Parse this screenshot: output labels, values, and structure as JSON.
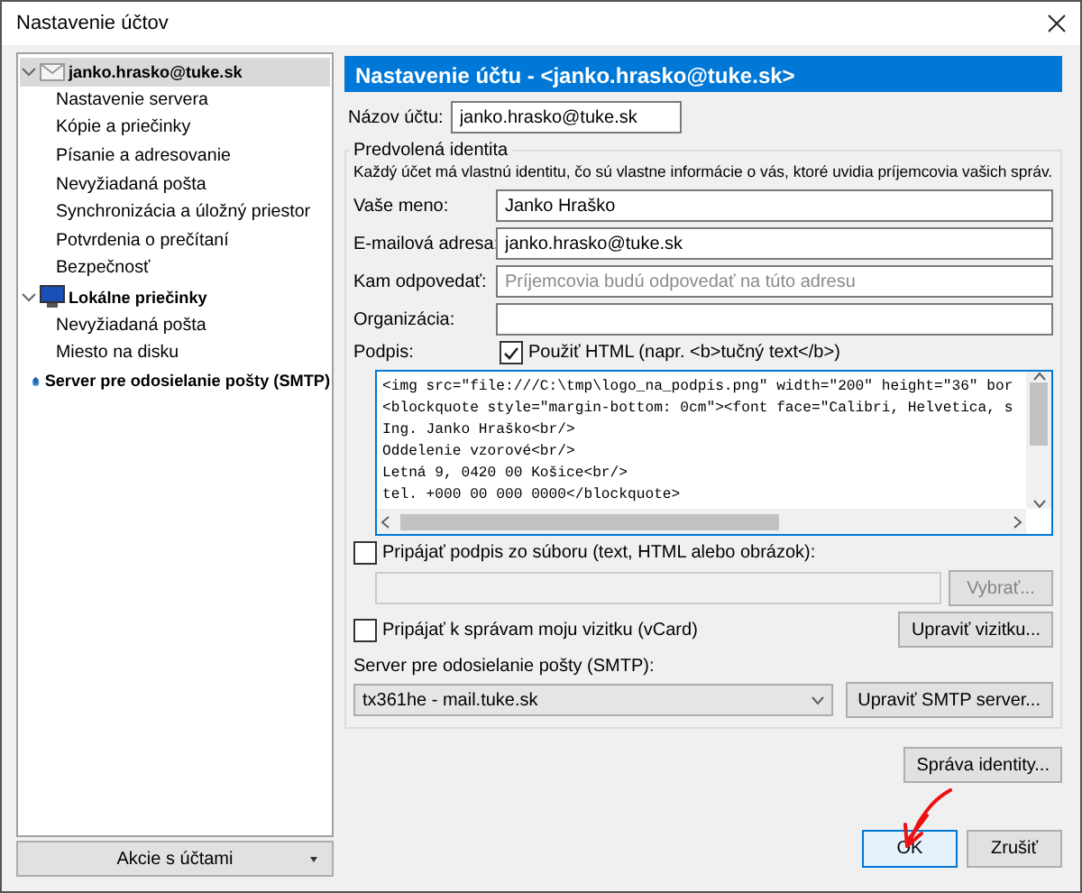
{
  "window": {
    "title": "Nastavenie účtov"
  },
  "tree": [
    {
      "label": "janko.hrasko@tuke.sk",
      "kind": "account",
      "selected": true,
      "expanded": true,
      "children": [
        {
          "label": "Nastavenie servera",
          "selected": false
        },
        {
          "label": "Kópie a priečinky",
          "selected": false
        },
        {
          "label": "Písanie a adresovanie",
          "selected": false
        },
        {
          "label": "Nevyžiadaná pošta",
          "selected": false
        },
        {
          "label": "Synchronizácia a úložný priestor",
          "selected": false
        },
        {
          "label": "Potvrdenia o prečítaní",
          "selected": false
        },
        {
          "label": "Bezpečnosť",
          "selected": false
        }
      ]
    },
    {
      "label": "Lokálne priečinky",
      "kind": "local",
      "selected": false,
      "expanded": true,
      "children": [
        {
          "label": "Nevyžiadaná pošta",
          "selected": false
        },
        {
          "label": "Miesto na disku",
          "selected": false
        }
      ]
    },
    {
      "label": "Server pre odosielanie pošty (SMTP)",
      "kind": "smtp",
      "selected": false
    }
  ],
  "account_actions": {
    "label": "Akcie s účtami"
  },
  "header": {
    "title": "Nastavenie účtu - <janko.hrasko@tuke.sk>"
  },
  "account_name": {
    "label": "Názov účtu:",
    "value": "janko.hrasko@tuke.sk"
  },
  "identity": {
    "legend": "Predvolená identita",
    "description": "Každý účet má vlastnú identitu, čo sú vlastne informácie o vás, ktoré uvidia príjemcovia vašich správ.",
    "fields": [
      {
        "label": "Vaše meno:",
        "value": "Janko Hraško"
      },
      {
        "label": "E-mailová adresa:",
        "value": "janko.hrasko@tuke.sk"
      },
      {
        "label": "Kam odpovedať:",
        "placeholder": "Príjemcovia budú odpovedať na túto adresu"
      },
      {
        "label": "Organizácia:"
      }
    ],
    "signature": {
      "label": "Podpis:",
      "use_html": {
        "label": "Použiť HTML (napr. <b>tučný text</b>)",
        "checked": true
      },
      "lines": [
        "<img src=\"file:///C:\\tmp\\logo_na_podpis.png\" width=\"200\" height=\"36\" bor",
        "<blockquote style=\"margin-bottom: 0cm\"><font face=\"Calibri, Helvetica, s",
        "Ing. Janko Hraško<br/>",
        "Oddelenie vzorové<br/>",
        "Letná 9, 0420 00 Košice<br/>",
        "tel. +000 00 000 0000</blockquote>"
      ]
    },
    "attach_file": {
      "label": "Pripájať podpis zo súboru (text, HTML alebo obrázok):",
      "checked": false,
      "button": "Vybrať...",
      "disabled": true
    },
    "attach_vcard": {
      "label": "Pripájať k správam moju vizitku (vCard)",
      "checked": false,
      "button": "Upraviť vizitku..."
    },
    "smtp": {
      "label": "Server pre odosielanie pošty (SMTP):",
      "value": "tx361he - mail.tuke.sk",
      "button": "Upraviť SMTP server..."
    }
  },
  "manage_identities": "Správa identity...",
  "buttons": [
    {
      "label": "OK",
      "default": true
    },
    {
      "label": "Zrušiť",
      "default": false
    }
  ]
}
